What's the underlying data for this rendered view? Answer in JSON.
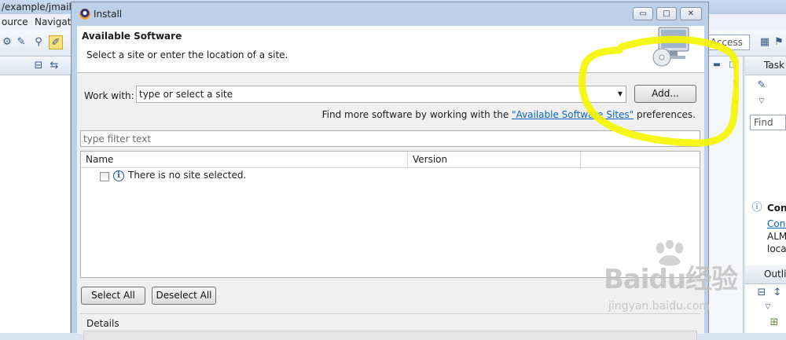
{
  "background": {
    "path_title": "/example/jmail/M",
    "menu": [
      "ource",
      "Navigate"
    ],
    "quick_access": "k Access",
    "right_pane": {
      "task_tab": "Task",
      "find_placeholder": "Find",
      "connect_title": "Con",
      "connect_link": "Conn",
      "line1": "ALM",
      "line2": "local",
      "outline_tab": "Outli"
    }
  },
  "dialog": {
    "title": "Install",
    "window_buttons": {
      "minimize": "▭",
      "maximize": "□",
      "close": "✕"
    },
    "banner": {
      "title": "Available Software",
      "description": "Select a site or enter the location of a site."
    },
    "work_with": {
      "label": "Work with:",
      "value": "type or select a site",
      "add_button": "Add..."
    },
    "find_more": {
      "prefix": "Find more software by working with the ",
      "link": "\"Available Software Sites\"",
      "suffix": " preferences."
    },
    "filter_placeholder": "type filter text",
    "table": {
      "columns": [
        "Name",
        "Version"
      ],
      "rows": [
        {
          "text": "There is no site selected.",
          "checked": false
        }
      ]
    },
    "buttons": {
      "select_all": "Select All",
      "deselect_all": "Deselect All"
    },
    "details_label": "Details"
  },
  "watermark": {
    "main": "Baidu经验",
    "sub": "jingyan.baidu.com"
  },
  "colors": {
    "highlight": "#f5f500",
    "link": "#0a63c9",
    "dialog_frame": "#bcd0e8"
  }
}
